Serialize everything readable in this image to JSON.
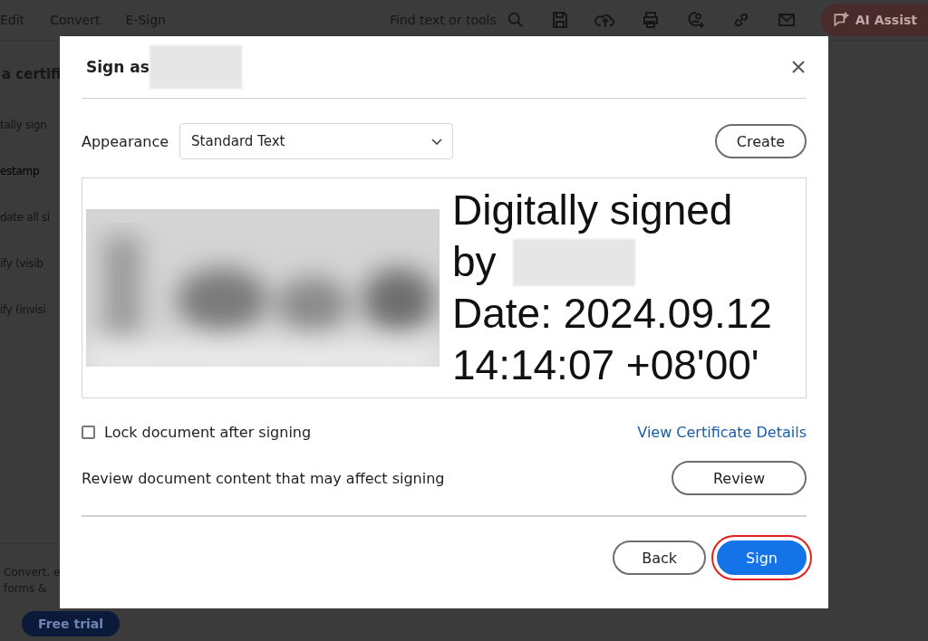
{
  "toolbar": {
    "menu": [
      {
        "label": "Edit"
      },
      {
        "label": "Convert"
      },
      {
        "label": "E-Sign"
      }
    ],
    "search": {
      "label": "Find text or tools"
    },
    "assistant": {
      "label": "AI Assist"
    }
  },
  "side_panel": {
    "heading": "a certifi",
    "items": [
      {
        "label": "tally sign",
        "disabled": true
      },
      {
        "label": "estamp",
        "disabled": false
      },
      {
        "label": "date all si",
        "disabled": true
      },
      {
        "label": "ify (visib",
        "disabled": true
      },
      {
        "label": "ify (invisi",
        "disabled": true
      }
    ],
    "promo": {
      "lines": [
        "Convert, e",
        "forms & "
      ],
      "button": "Free trial"
    }
  },
  "dialog": {
    "title": "Sign as",
    "appearance": {
      "label": "Appearance",
      "value": "Standard Text",
      "create": "Create"
    },
    "preview": {
      "lines": [
        "Digitally signed",
        "by",
        "Date: 2024.09.12",
        "14:14:07 +08'00'"
      ]
    },
    "lock": {
      "label": "Lock document after signing",
      "checked": false
    },
    "certificate_link": "View Certificate Details",
    "review": {
      "text": "Review document content that may affect signing",
      "button": "Review"
    },
    "buttons": [
      {
        "label": "Back",
        "kind": "secondary",
        "highlighted": false
      },
      {
        "label": "Sign",
        "kind": "primary",
        "highlighted": true
      }
    ]
  }
}
